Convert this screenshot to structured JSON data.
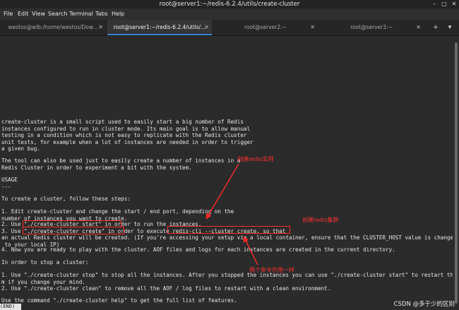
{
  "window": {
    "title": "root@server1:~/redis-6.2.4/utils/create-cluster"
  },
  "menu": [
    "File",
    "Edit",
    "View",
    "Search",
    "Terminal",
    "Tabs",
    "Help"
  ],
  "tabs": [
    {
      "label": "westos@wlb:/home/westos/Dow..."
    },
    {
      "label": "root@server1:~/redis-6.2.4/utils/..."
    },
    {
      "label": "root@server2:~"
    },
    {
      "label": "root@server3:~"
    }
  ],
  "terminal": {
    "lines": [
      "create-cluster is a small script used to easily start a big number of Redis",
      "instances configured to run in cluster mode. Its main goal is to allow manual",
      "testing in a condition which is not easy to replicate with the Redis cluster",
      "unit tests, for example when a lot of instances are needed in order to trigger",
      "a given bug.",
      "",
      "The tool can also be used just to easily create a number of instances in a",
      "Redis Cluster in order to experiment a bit with the system.",
      "",
      "USAGE",
      "---",
      "",
      "To create a cluster, follow these steps:",
      "",
      "1. Edit create-cluster and change the start / end port, depending on the",
      "number of instances you want to create.",
      "2. Use \"./create-cluster start\" in order to run the instances.",
      "3. Use \"./create-cluster create\" in order to execute redis-cli --cluster create, so that",
      "an actual Redis cluster will be created. (If you're accessing your setup via a local container, ensure that the CLUSTER_HOST value is changed",
      " to your local IP)",
      "4. Now you are ready to play with the cluster. AOF files and logs for each instances are created in the current directory.",
      "",
      "In order to stop a cluster:",
      "",
      "1. Use \"./create-cluster stop\" to stop all the instances. After you stopped the instances you can use \"./create-cluster start\" to restart the",
      "m if you change your mind.",
      "2. Use \"./create-cluster clean\" to remove all the AOF / log files to restart with a clean environment.",
      "",
      "Use the command \"./create-cluster help\" to get the full list of features."
    ],
    "status": "(END)"
  },
  "annotations": {
    "create_instances": "创建redis实例",
    "create_cluster": "创建redis集群",
    "same_effect": "两个命令作用一样"
  },
  "watermark": "CSDN @多于少的区别",
  "colors": {
    "annotation": "#ff2a2a",
    "tab_accent": "#3d7fd6"
  }
}
